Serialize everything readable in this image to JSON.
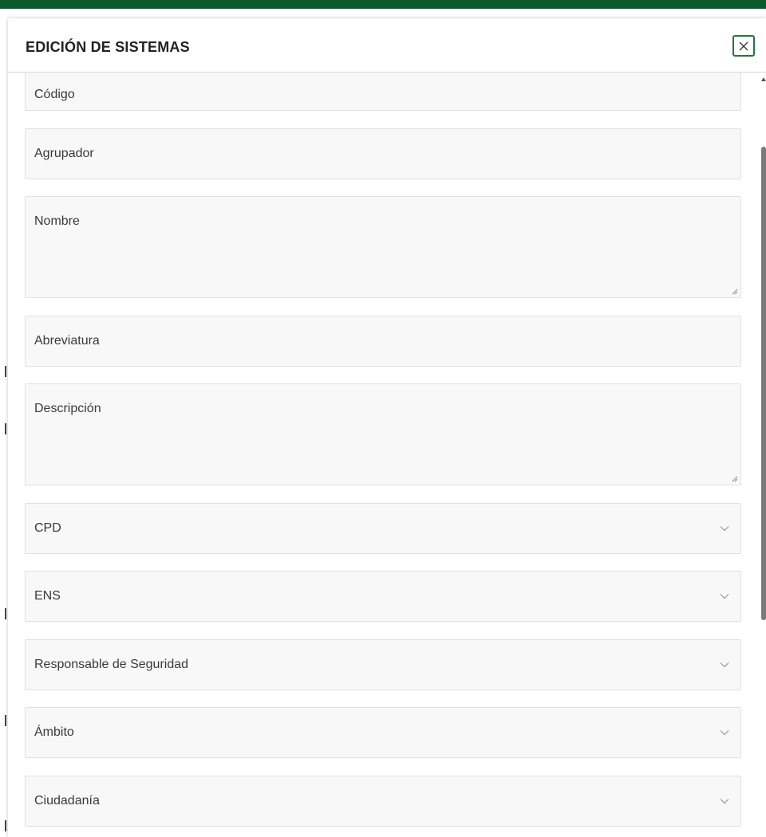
{
  "dialog": {
    "title": "EDICIÓN DE SISTEMAS",
    "close_icon": "close-icon"
  },
  "fields": {
    "codigo": "Código",
    "agrupador": "Agrupador",
    "nombre": "Nombre",
    "abreviatura": "Abreviatura",
    "descripcion": "Descripción",
    "cpd": "CPD",
    "ens": "ENS",
    "responsable": "Responsable de Seguridad",
    "ambito": "Ámbito",
    "ciudadania": "Ciudadanía"
  },
  "colors": {
    "brand_green": "#0b5a2b",
    "close_border": "#1e7a3c",
    "field_bg": "#f8f8f8",
    "field_border": "#e0e0e0"
  },
  "icons": {
    "dropdown": "chevron-down-icon",
    "resize": "resize-grip-icon"
  }
}
